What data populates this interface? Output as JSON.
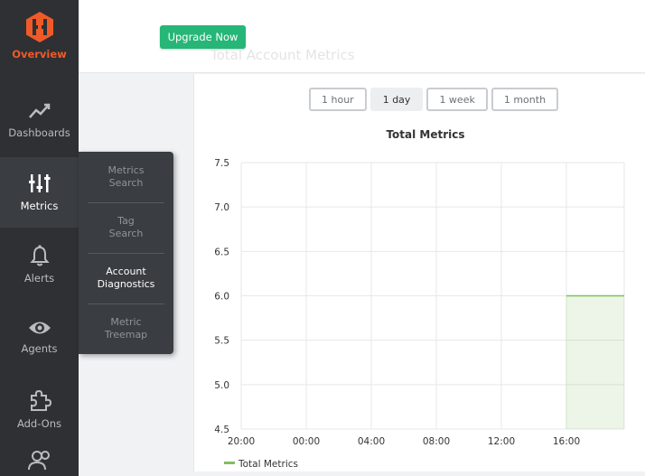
{
  "nav": {
    "items": [
      {
        "label": "Overview",
        "icon": "hexagon-logo-icon"
      },
      {
        "label": "Dashboards",
        "icon": "trend-line-icon"
      },
      {
        "label": "Metrics",
        "icon": "metrics-bars-icon"
      },
      {
        "label": "Alerts",
        "icon": "bell-icon"
      },
      {
        "label": "Agents",
        "icon": "eye-icon"
      },
      {
        "label": "Add-Ons",
        "icon": "puzzle-icon"
      },
      {
        "label": "",
        "icon": "users-icon"
      }
    ]
  },
  "submenu": {
    "items": [
      {
        "line1": "Metrics",
        "line2": "Search"
      },
      {
        "line1": "Tag",
        "line2": "Search"
      },
      {
        "line1": "Account",
        "line2": "Diagnostics"
      },
      {
        "line1": "Metric",
        "line2": "Treemap"
      }
    ]
  },
  "banner": {
    "upgrade_label": "Upgrade Now",
    "faded_title": "Total Account Metrics"
  },
  "ranges": {
    "items": [
      "1 hour",
      "1 day",
      "1 week",
      "1 month"
    ],
    "active": "1 day"
  },
  "colors": {
    "nav_bg": "#2e3033",
    "accent_orange": "#f05a28",
    "upgrade_green": "#26b677",
    "series_green": "#7fbf5e"
  },
  "chart_data": {
    "type": "area",
    "title": "Total Metrics",
    "x_ticks": [
      "20:00",
      "00:00",
      "04:00",
      "08:00",
      "12:00",
      "16:00"
    ],
    "y_ticks": [
      "7.5",
      "7.0",
      "6.5",
      "6.0",
      "5.5",
      "5.0",
      "4.5"
    ],
    "ylim": [
      4.5,
      7.5
    ],
    "grid": true,
    "legend_position": "bottom-left",
    "series": [
      {
        "name": "Total Metrics",
        "x": [
          "16:00",
          "19:40"
        ],
        "values": [
          6.0,
          6.0
        ]
      }
    ]
  }
}
